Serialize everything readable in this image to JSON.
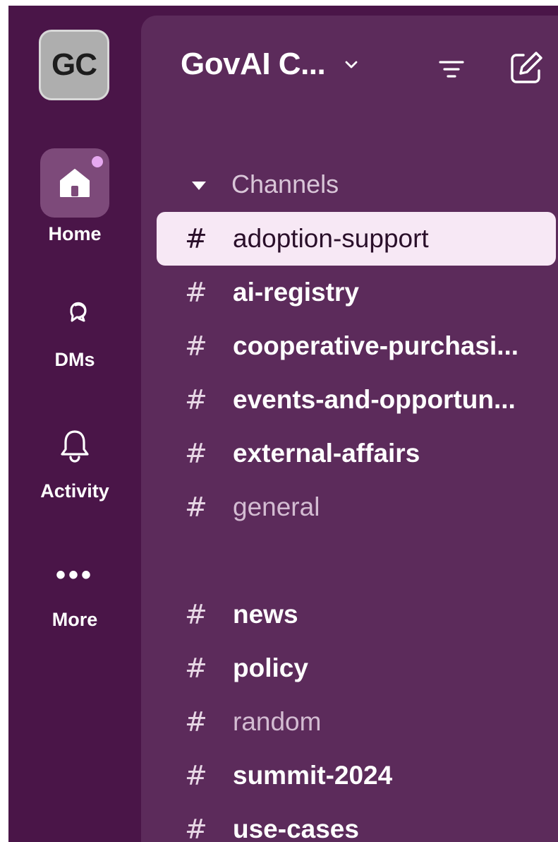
{
  "workspace": {
    "initials": "GC",
    "name": "GovAI C..."
  },
  "rail": {
    "home": "Home",
    "dms": "DMs",
    "activity": "Activity",
    "more": "More",
    "more_glyph": "•••"
  },
  "sidebar": {
    "section_label": "Channels",
    "hash_glyph": "#",
    "channels": [
      {
        "name": "adoption-support",
        "state": "selected"
      },
      {
        "name": "ai-registry",
        "state": "unread"
      },
      {
        "name": "cooperative-purchasi...",
        "state": "unread"
      },
      {
        "name": "events-and-opportun...",
        "state": "unread"
      },
      {
        "name": "external-affairs",
        "state": "unread"
      },
      {
        "name": "general",
        "state": "read"
      },
      {
        "name": "news",
        "state": "unread"
      },
      {
        "name": "policy",
        "state": "unread"
      },
      {
        "name": "random",
        "state": "read"
      },
      {
        "name": "summit-2024",
        "state": "unread"
      },
      {
        "name": "use-cases",
        "state": "unread"
      }
    ]
  },
  "icons": {
    "home": "home-icon",
    "dms": "dms-icon",
    "activity": "bell-icon",
    "chevron": "chevron-down-icon",
    "filter": "filter-icon",
    "compose": "compose-icon"
  },
  "colors": {
    "rail_bg": "#4a1548",
    "panel_bg": "#5c2b5b",
    "selected_bg": "#f7e8f5",
    "notification_dot": "#e6a8f0"
  }
}
